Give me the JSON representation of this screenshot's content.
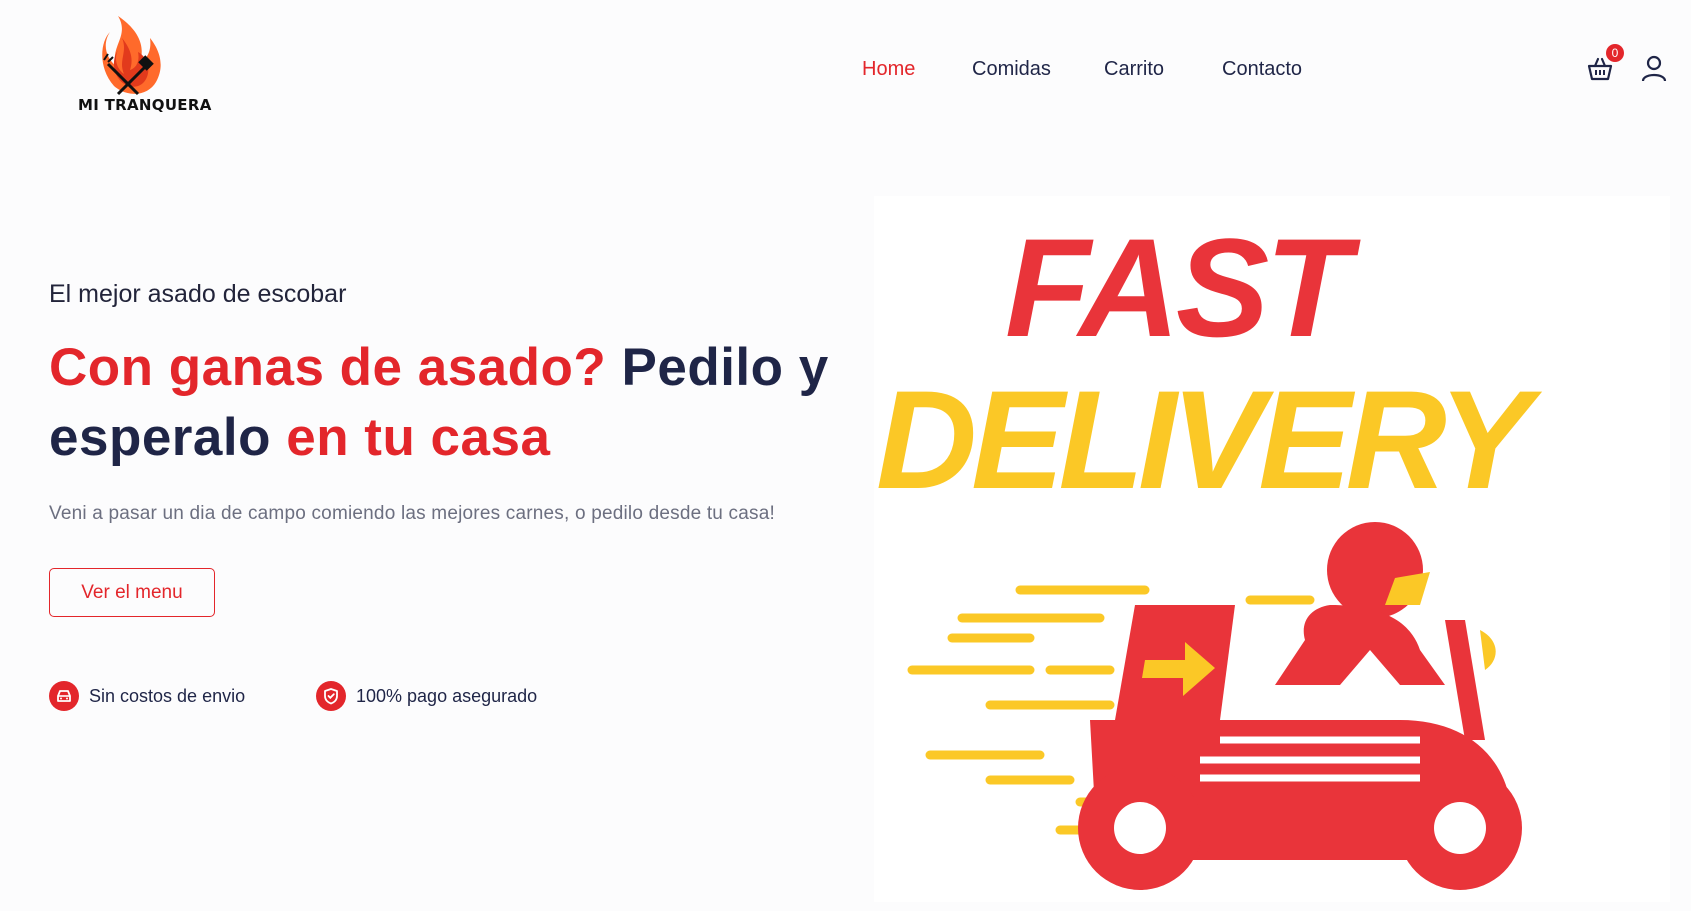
{
  "brand": {
    "name": "MI TRANQUERA"
  },
  "nav": {
    "items": [
      {
        "label": "Home",
        "active": true
      },
      {
        "label": "Comidas",
        "active": false
      },
      {
        "label": "Carrito",
        "active": false
      },
      {
        "label": "Contacto",
        "active": false
      }
    ]
  },
  "cart": {
    "count": "0",
    "icon": "basket-icon"
  },
  "user": {
    "icon": "user-icon"
  },
  "hero": {
    "eyebrow": "El mejor asado de escobar",
    "headline_part1": "Con ganas de asado?",
    "headline_part2": " Pedilo y esperalo ",
    "headline_part3": "en tu casa",
    "lead": "Veni a pasar un dia de campo comiendo las mejores carnes, o pedilo desde tu casa!",
    "cta": "Ver el menu"
  },
  "features": [
    {
      "icon": "car-icon",
      "label": "Sin costos de envio"
    },
    {
      "icon": "shield-icon",
      "label": "100% pago asegurado"
    }
  ],
  "promo_image": {
    "line1": "FAST",
    "line2": "DELIVERY"
  },
  "colors": {
    "accent": "#e3262b",
    "text_dark": "#1f2547",
    "muted": "#6c6f80",
    "delivery_yellow": "#fbc826",
    "delivery_red": "#e9343a"
  }
}
